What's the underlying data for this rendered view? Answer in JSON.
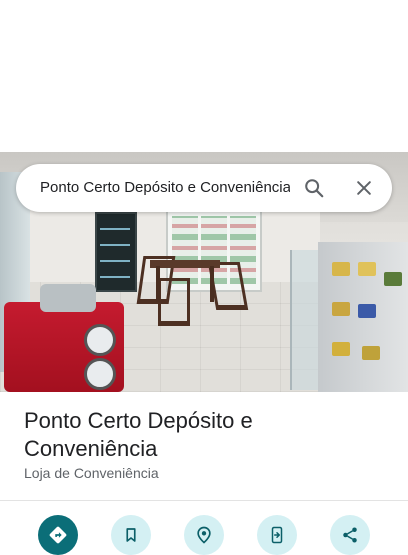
{
  "search": {
    "query": "Ponto Certo Depósito e Conveniência"
  },
  "place": {
    "name": "Ponto Certo Depósito e Conveniência",
    "category": "Loja de Conveniência"
  },
  "icons": {
    "search": "search-icon",
    "close": "close-icon",
    "directions": "directions-icon",
    "save": "bookmark-icon",
    "nearby": "nearby-icon",
    "send": "send-to-phone-icon",
    "share": "share-icon"
  },
  "colors": {
    "primary_action": "#0b6e78",
    "secondary_action": "#d4f0f3",
    "icon_dark": "#0b5f68"
  }
}
